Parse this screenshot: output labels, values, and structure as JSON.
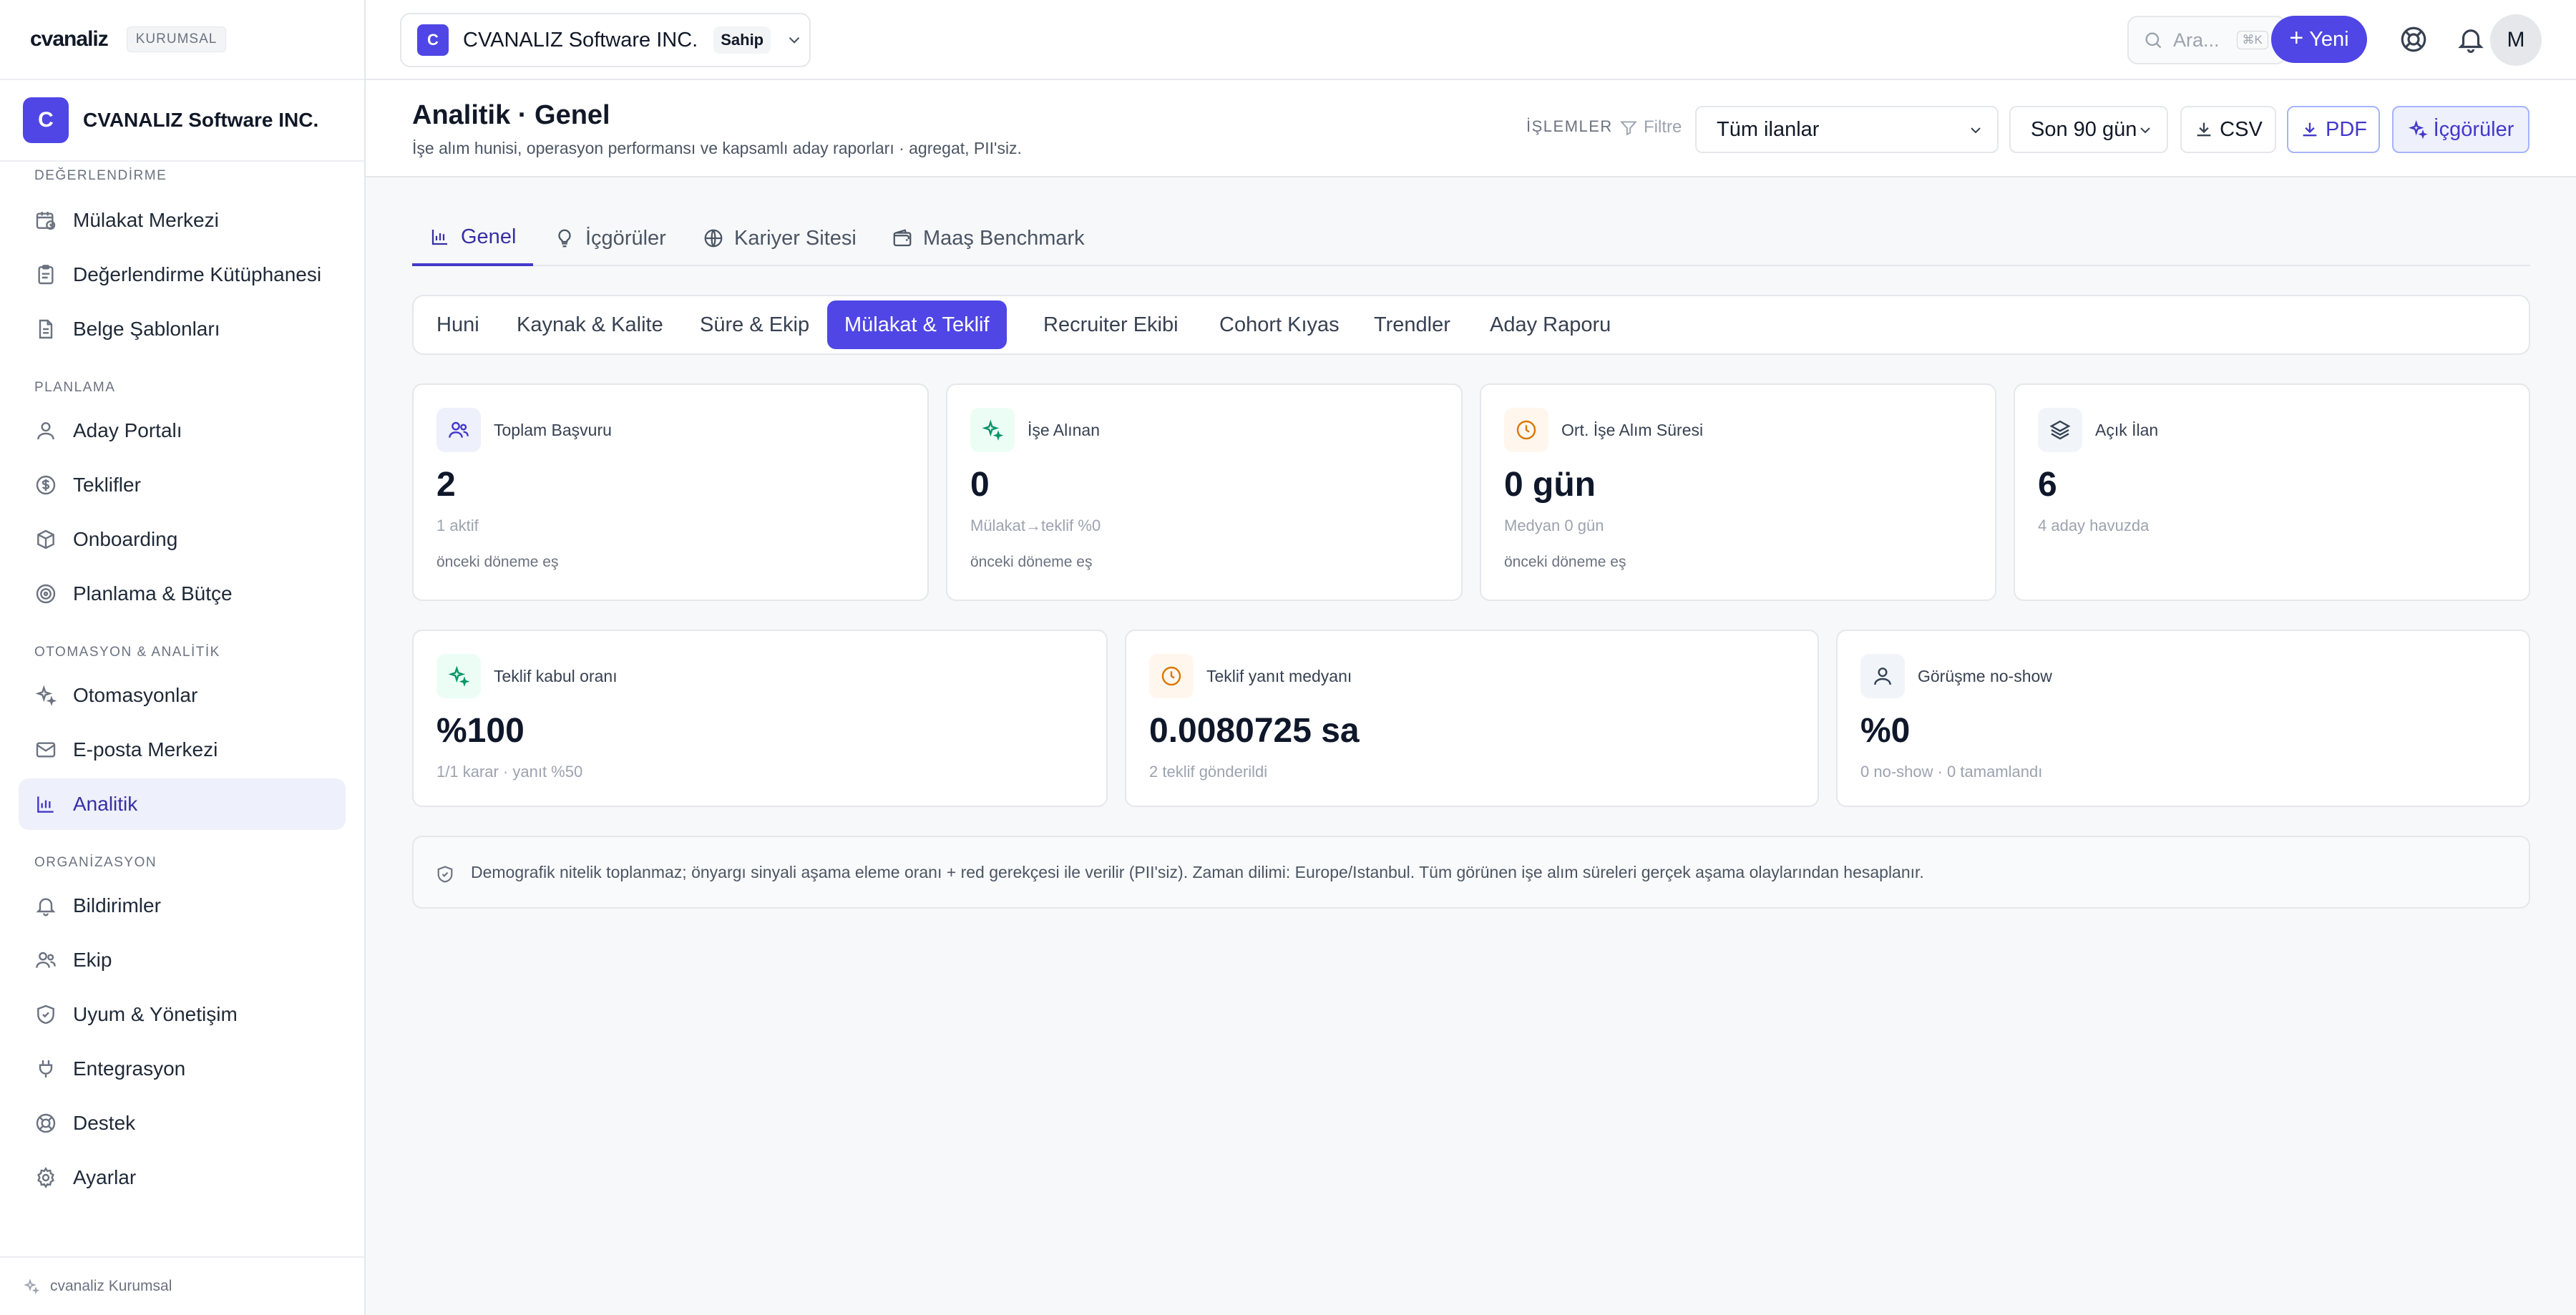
{
  "app": {
    "logo": "cvanaliz",
    "plan_badge": "KURUMSAL",
    "footer": "cvanaliz Kurumsal"
  },
  "org": {
    "initial": "C",
    "name": "CVANALIZ Software INC."
  },
  "sidebar": {
    "sections": [
      {
        "title": "DEĞERLENDİRME",
        "items": [
          {
            "label": "Mülakat Merkezi",
            "icon": "calendar-clock-icon"
          },
          {
            "label": "Değerlendirme Kütüphanesi",
            "icon": "clipboard-icon"
          },
          {
            "label": "Belge Şablonları",
            "icon": "document-icon"
          }
        ]
      },
      {
        "title": "PLANLAMA",
        "items": [
          {
            "label": "Aday Portalı",
            "icon": "user-icon"
          },
          {
            "label": "Teklifler",
            "icon": "dollar-icon"
          },
          {
            "label": "Onboarding",
            "icon": "box-icon"
          },
          {
            "label": "Planlama & Bütçe",
            "icon": "target-icon"
          }
        ]
      },
      {
        "title": "OTOMASYON & ANALİTİK",
        "items": [
          {
            "label": "Otomasyonlar",
            "icon": "sparkles-icon"
          },
          {
            "label": "E-posta Merkezi",
            "icon": "mail-icon"
          },
          {
            "label": "Analitik",
            "icon": "bar-chart-icon",
            "active": true
          }
        ]
      },
      {
        "title": "ORGANİZASYON",
        "items": [
          {
            "label": "Bildirimler",
            "icon": "bell-icon"
          },
          {
            "label": "Ekip",
            "icon": "users-icon"
          },
          {
            "label": "Uyum & Yönetişim",
            "icon": "shield-icon"
          },
          {
            "label": "Entegrasyon",
            "icon": "plug-icon"
          },
          {
            "label": "Destek",
            "icon": "lifebuoy-icon"
          },
          {
            "label": "Ayarlar",
            "icon": "gear-icon"
          }
        ]
      }
    ]
  },
  "topbar": {
    "workspace": {
      "initial": "C",
      "name": "CVANALIZ Software INC.",
      "role": "Sahip"
    },
    "search_placeholder": "Ara...",
    "search_shortcut": "⌘K",
    "new_button": "Yeni",
    "user_initial": "M"
  },
  "header": {
    "title": "Analitik · Genel",
    "subtitle": "İşe alım hunisi, operasyon performansı ve kapsamlı aday raporları · agregat, PII'siz.",
    "ops_label": "İŞLEMLER",
    "filter_label": "Filtre",
    "listing_select": "Tüm ilanlar",
    "period_select": "Son 90 gün",
    "csv_button": "CSV",
    "pdf_button": "PDF",
    "insights_button": "İçgörüler"
  },
  "tabs": [
    {
      "label": "Genel",
      "icon": "bar-chart-icon",
      "active": true
    },
    {
      "label": "İçgörüler",
      "icon": "lightbulb-icon"
    },
    {
      "label": "Kariyer Sitesi",
      "icon": "globe-icon"
    },
    {
      "label": "Maaş Benchmark",
      "icon": "wallet-icon"
    }
  ],
  "subtabs": [
    {
      "label": "Huni"
    },
    {
      "label": "Kaynak & Kalite"
    },
    {
      "label": "Süre & Ekip"
    },
    {
      "label": "Mülakat & Teklif",
      "active": true
    },
    {
      "label": "Recruiter Ekibi"
    },
    {
      "label": "Cohort Kıyas"
    },
    {
      "label": "Trendler"
    },
    {
      "label": "Aday Raporu"
    }
  ],
  "kpis_top": [
    {
      "label": "Toplam Başvuru",
      "value": "2",
      "sub": "1 aktif",
      "compare": "önceki döneme eş",
      "icon": "users-icon",
      "tone": "indigo"
    },
    {
      "label": "İşe Alınan",
      "value": "0",
      "sub": "Mülakat→teklif %0",
      "compare": "önceki döneme eş",
      "icon": "sparkles-icon",
      "tone": "green"
    },
    {
      "label": "Ort. İşe Alım Süresi",
      "value": "0 gün",
      "sub": "Medyan 0 gün",
      "compare": "önceki döneme eş",
      "icon": "clock-icon",
      "tone": "amber"
    },
    {
      "label": "Açık İlan",
      "value": "6",
      "sub": "4 aday havuzda",
      "compare": "",
      "icon": "layers-icon",
      "tone": "slate"
    }
  ],
  "kpis_bottom": [
    {
      "label": "Teklif kabul oranı",
      "value": "%100",
      "sub": "1/1 karar · yanıt %50",
      "icon": "sparkles-icon",
      "tone": "green"
    },
    {
      "label": "Teklif yanıt medyanı",
      "value": "0.0080725 sa",
      "sub": "2 teklif gönderildi",
      "icon": "clock-icon",
      "tone": "amber"
    },
    {
      "label": "Görüşme no-show",
      "value": "%0",
      "sub": "0 no-show · 0 tamamlandı",
      "icon": "user-icon",
      "tone": "slate"
    }
  ],
  "notice": "Demografik nitelik toplanmaz; önyargı sinyali aşama eleme oranı + red gerekçesi ile verilir (PII'siz). Zaman dilimi: Europe/Istanbul. Tüm görünen işe alım süreleri gerçek aşama olaylarından hesaplanır."
}
